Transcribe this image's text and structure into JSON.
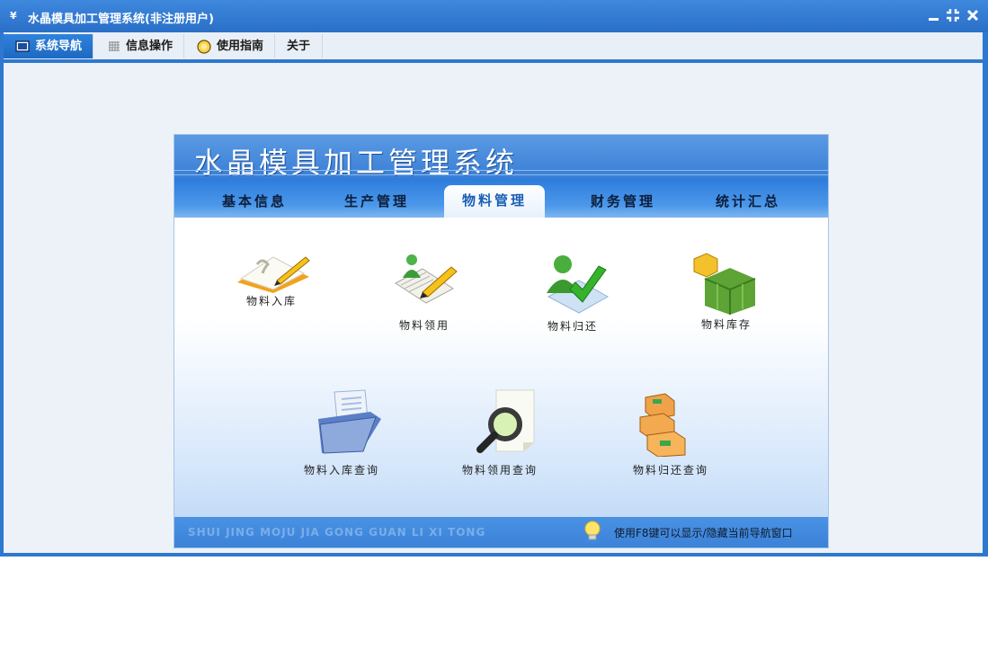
{
  "window": {
    "title": "水晶模具加工管理系统(非注册用户)",
    "app_icon_glyph": "¥"
  },
  "menu": {
    "items": [
      {
        "label": "系统导航",
        "icon": "monitor-icon",
        "active": true
      },
      {
        "label": "信息操作",
        "icon": "grid-icon",
        "active": false
      },
      {
        "label": "使用指南",
        "icon": "help-circle-icon",
        "active": false
      },
      {
        "label": "关于",
        "icon": "",
        "active": false
      }
    ]
  },
  "panel": {
    "title": "水晶模具加工管理系统",
    "tabs": [
      {
        "label": "基本信息"
      },
      {
        "label": "生产管理"
      },
      {
        "label": "物料管理",
        "active": true
      },
      {
        "label": "财务管理"
      },
      {
        "label": "统计汇总"
      }
    ],
    "items_row1": [
      {
        "label": "物料入库",
        "icon": "notebook-pen-icon"
      },
      {
        "label": "物料领用",
        "icon": "user-pencil-icon"
      },
      {
        "label": "物料归还",
        "icon": "user-check-icon"
      },
      {
        "label": "物料库存",
        "icon": "cubes-icon"
      }
    ],
    "items_row2": [
      {
        "label": "物料入库查询",
        "icon": "folder-docs-icon"
      },
      {
        "label": "物料领用查询",
        "icon": "magnifier-doc-icon"
      },
      {
        "label": "物料归还查询",
        "icon": "boxes-icon"
      }
    ],
    "footer": {
      "left_text": "SHUI JING MOJU JIA GONG GUAN LI XI TONG",
      "right_text": "使用F8键可以显示/隐藏当前导航窗口"
    }
  },
  "colors": {
    "titlebar": "#2f78d0",
    "menu_active": "#2f82dc",
    "panel_header": "#4a8de0"
  }
}
